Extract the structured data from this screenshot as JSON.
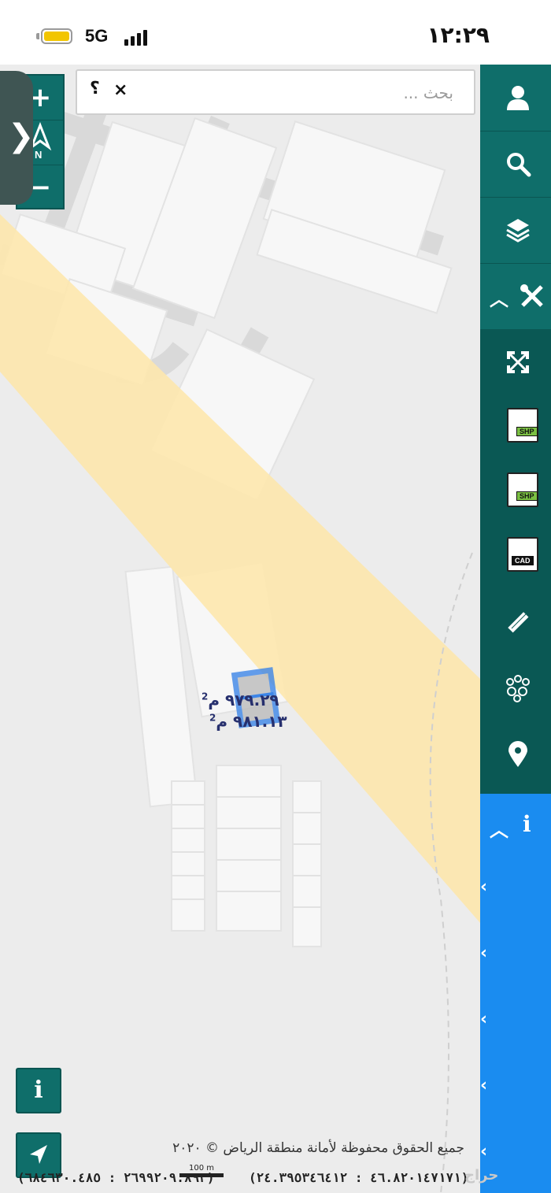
{
  "status_bar": {
    "network": "5G",
    "time": "١٢:٢٩"
  },
  "search": {
    "placeholder": "بحث ...",
    "clear_glyph": "×",
    "help_glyph": "؟"
  },
  "zoom": {
    "in_glyph": "+",
    "out_glyph": "−",
    "compass_letter": "N"
  },
  "drawer": {
    "glyph": "❯"
  },
  "toolbar": {
    "colors": {
      "top": "#0f6e6a",
      "mid": "#0a5854",
      "blue": "#1a8cf0"
    },
    "items": [
      {
        "icon": "user-icon"
      },
      {
        "icon": "search-icon"
      },
      {
        "icon": "layers-icon"
      },
      {
        "icon": "tools-icon",
        "chevron": "^"
      },
      {
        "icon": "fullscreen-icon"
      },
      {
        "icon": "shp-import-icon",
        "badge": "SHP"
      },
      {
        "icon": "shp-export-icon",
        "badge": "SHP"
      },
      {
        "icon": "cad-file-icon",
        "badge": "CAD"
      },
      {
        "icon": "measure-icon"
      },
      {
        "icon": "bubbles-icon"
      },
      {
        "icon": "location-pin-icon"
      },
      {
        "icon": "info-icon",
        "chevron": "^"
      }
    ],
    "info_glyph": "i"
  },
  "map": {
    "parcel_area_1": "٩٧٩.٢٩ م",
    "parcel_area_2": "٩٨١.١٣ م",
    "area_unit_sup": "2",
    "highlight_color": "#3d86e8",
    "road_color": "#fde7ad"
  },
  "footer": {
    "info_glyph": "i",
    "copyright": "جميع الحقوق محفوظة لأمانة منطقة الرياض © ٢٠٢٠",
    "coord_y": "(٢٦٩٩٢٠٩.٨٩٣ : ٦٨٤٦٣٠.٤٨٥)",
    "coord_x": "(٤٦.٨٢٠١٤٧١٧١ : ٢٤.٣٩٥٣٤٦٤١٢)",
    "scale_label": "100 m",
    "watermark": "حراج"
  }
}
